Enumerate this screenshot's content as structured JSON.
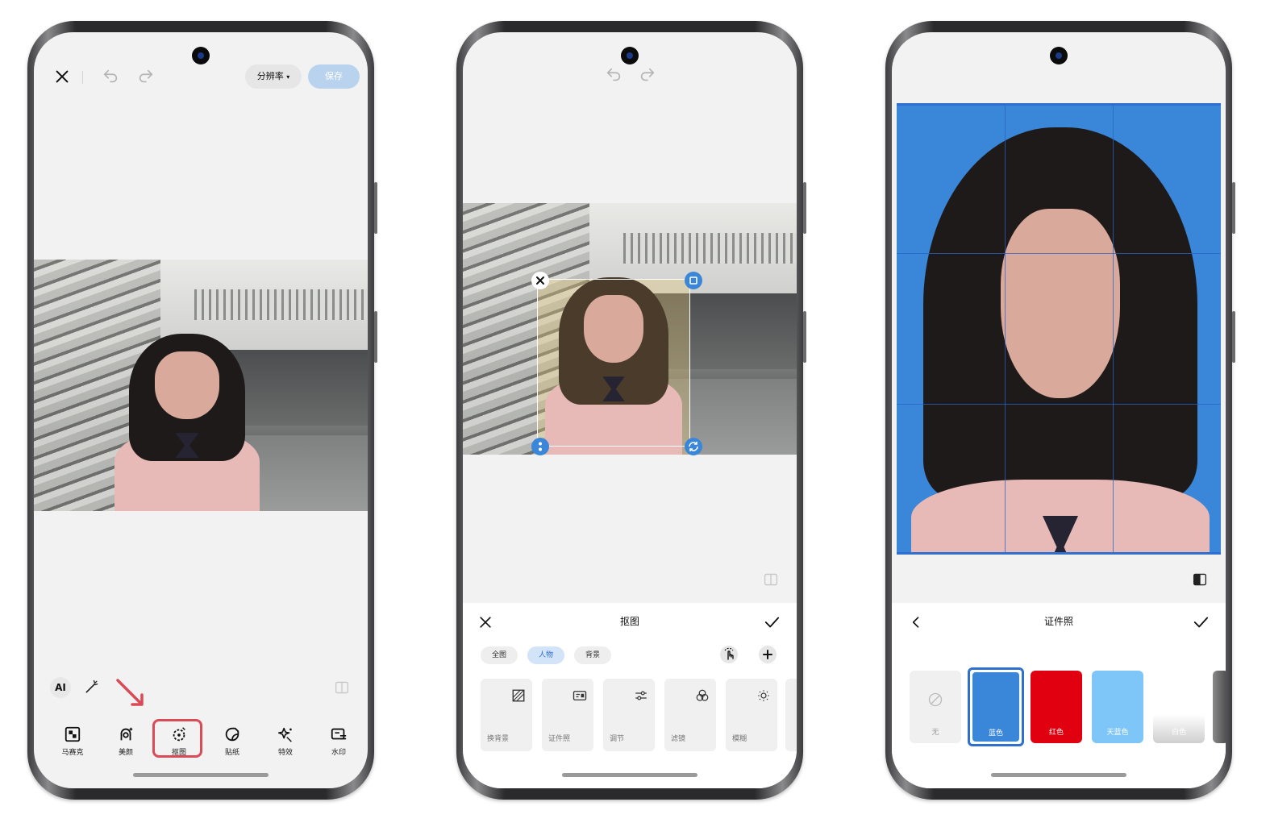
{
  "phone1": {
    "top": {
      "resolution_label": "分辨率",
      "save_label": "保存"
    },
    "mini": {
      "ai_label": "AI"
    },
    "toolbar": [
      {
        "label": "马赛克",
        "icon": "mosaic-icon"
      },
      {
        "label": "美颜",
        "icon": "beauty-icon"
      },
      {
        "label": "抠图",
        "icon": "cutout-icon"
      },
      {
        "label": "贴纸",
        "icon": "sticker-icon"
      },
      {
        "label": "特效",
        "icon": "effects-icon"
      },
      {
        "label": "水印",
        "icon": "watermark-icon"
      }
    ],
    "highlight_color": "#d94b57"
  },
  "phone2": {
    "panel_title": "抠图",
    "chips": [
      {
        "label": "全图",
        "active": false
      },
      {
        "label": "人物",
        "active": true
      },
      {
        "label": "背景",
        "active": false
      }
    ],
    "tools": [
      {
        "label": "换背景",
        "icon": "background-icon"
      },
      {
        "label": "证件照",
        "icon": "id-card-icon"
      },
      {
        "label": "调节",
        "icon": "sliders-icon"
      },
      {
        "label": "滤镜",
        "icon": "filter-icon"
      },
      {
        "label": "模糊",
        "icon": "blur-icon"
      }
    ]
  },
  "phone3": {
    "panel_title": "证件照",
    "swatches": [
      {
        "label": "无",
        "color": "#f0f0f0"
      },
      {
        "label": "蓝色",
        "color": "#3a86d8",
        "selected": true
      },
      {
        "label": "红色",
        "color": "#e00010"
      },
      {
        "label": "天蓝色",
        "color": "#7fc6f8"
      },
      {
        "label": "白色",
        "color": "#ffffff"
      }
    ],
    "background_color": "#3a86d8"
  }
}
